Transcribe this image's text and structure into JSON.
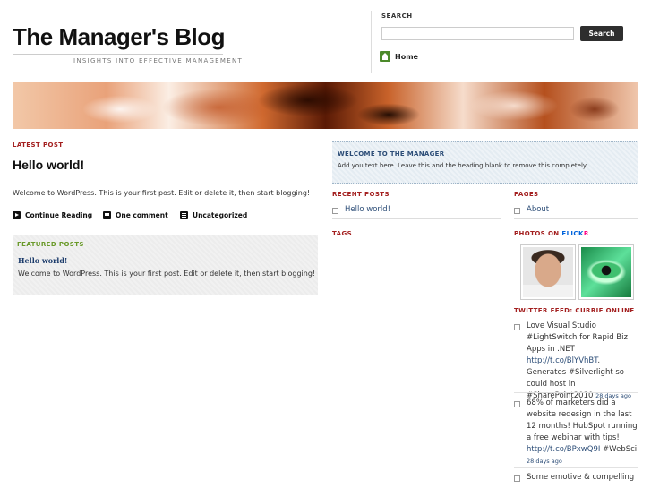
{
  "header": {
    "blog_title": "The Manager's Blog",
    "tagline": "INSIGHTS INTO EFFECTIVE MANAGEMENT"
  },
  "search": {
    "heading": "SEARCH",
    "placeholder": "",
    "value": "",
    "button_label": "Search"
  },
  "nav": {
    "home_label": "Home",
    "home_icon": "home-icon"
  },
  "main": {
    "latest_label": "LATEST POST",
    "post_title": "Hello world!",
    "post_excerpt": "Welcome to WordPress. This is your first post. Edit or delete it, then start blogging!",
    "meta": {
      "continue_label": "Continue Reading",
      "comments_label": "One comment",
      "category_label": "Uncategorized"
    },
    "featured": {
      "label": "FEATURED POSTS",
      "title": "Hello world!",
      "excerpt": "Welcome to WordPress. This is your first post. Edit or delete it, then start blogging!"
    }
  },
  "sidebar": {
    "welcome": {
      "title": "WELCOME TO THE MANAGER",
      "text": "Add you text here. Leave this and the heading blank to remove this completely."
    },
    "recent_posts": {
      "label": "RECENT POSTS",
      "items": [
        "Hello world!"
      ]
    },
    "tags_label": "TAGS",
    "pages": {
      "label": "PAGES",
      "items": [
        "About"
      ]
    },
    "photos": {
      "label_prefix": "PHOTOS ON ",
      "flickr_part1": "FLICK",
      "flickr_part2": "R"
    },
    "twitter": {
      "label": "TWITTER FEED: CURRIE ONLINE",
      "tweets": [
        {
          "text_before": "Love Visual Studio #LightSwitch for Rapid Biz Apps in .NET ",
          "link": "http://t.co/BlYVhBT",
          "text_after": ". Generates #Silverlight so could host in #SharePoint2010 ",
          "date": "28 days ago"
        },
        {
          "text_before": "68% of marketers did a website redesign in the last 12 months! HubSpot running a free webinar with tips! ",
          "link": "http://t.co/BPxwQ9I",
          "text_after": " #WebSci ",
          "date": "28 days ago"
        },
        {
          "text_before": "Some emotive & compelling",
          "link": "",
          "text_after": "",
          "date": ""
        }
      ]
    }
  },
  "colors": {
    "section_label": "#a31f1f",
    "link_blue": "#2c4d77",
    "featured_green": "#6a9a2a",
    "search_button": "#2e2e2e",
    "home_icon_green": "#4c8a2b"
  }
}
